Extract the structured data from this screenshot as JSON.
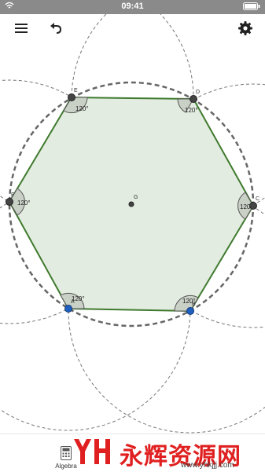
{
  "status_bar": {
    "time": "09:41"
  },
  "toolbar": {
    "menu_icon": "hamburger-icon",
    "undo_icon": "undo-icon",
    "settings_icon": "gear-icon"
  },
  "construction": {
    "points": {
      "A": {
        "label": "A",
        "color": "#1f5fbf"
      },
      "B": {
        "label": "B",
        "color": "#1f5fbf"
      },
      "C": {
        "label": "C",
        "color": "#444444"
      },
      "D": {
        "label": "D",
        "color": "#444444"
      },
      "E": {
        "label": "E",
        "color": "#444444"
      },
      "F": {
        "label": "F",
        "color": "#444444"
      },
      "G": {
        "label": "G",
        "color": "#444444"
      }
    },
    "angles": {
      "A": "120°",
      "B": "120°",
      "C": "120°",
      "D": "120°",
      "E": "120°",
      "F": "120°"
    },
    "polygon_fill": "#e3ece0",
    "polygon_stroke": "#3f7a2e"
  },
  "bottom_bar": {
    "algebra_label": "Algebra",
    "algebra_icon": "calculator-icon"
  },
  "watermark": {
    "logo_text": "永辉资源网",
    "url": "www.yhkjjj.com"
  }
}
